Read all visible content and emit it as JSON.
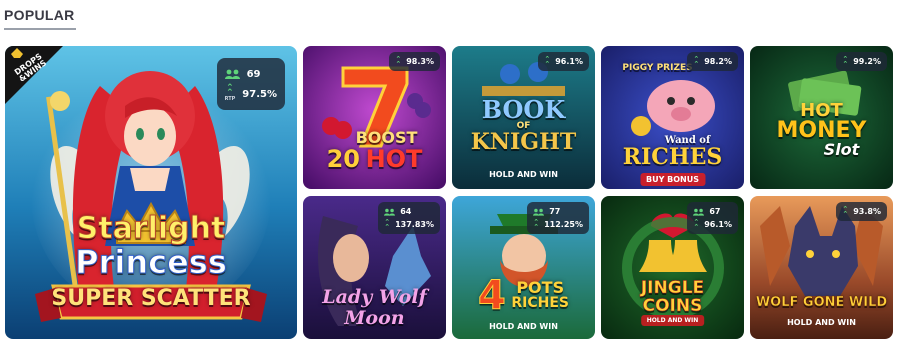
{
  "section": {
    "title": "POPULAR"
  },
  "featured": {
    "title_line1": "Starlight",
    "title_line2": "Princess",
    "title_line3": "SUPER SCATTER",
    "badge_line1": "DROPS",
    "badge_line2": "&WINS",
    "players": "69",
    "rtp": "97.5%",
    "rtp_label": "RTP"
  },
  "games": [
    {
      "id": "boost-hot",
      "title_line1": "20",
      "title_line2": "BOOST",
      "title_line3": "HOT",
      "rtp": "98.3%"
    },
    {
      "id": "book-of-knight",
      "title_line1": "BOOK",
      "title_line2": "OF",
      "title_line3": "KNIGHT",
      "tag": "HOLD AND WIN",
      "rtp": "96.1%"
    },
    {
      "id": "wand-of-riches",
      "title_line1": "PIGGY PRIZES",
      "title_line2": "Wand of",
      "title_line3": "RICHES",
      "tag": "BUY BONUS",
      "rtp": "98.2%"
    },
    {
      "id": "hot-money",
      "title_line1": "HOT",
      "title_line2": "MONEY",
      "title_line3": "Slot",
      "rtp": "99.2%"
    },
    {
      "id": "lady-wolf-moon",
      "title_line1": "Lady Wolf",
      "title_line2": "Moon",
      "players": "64",
      "rtp": "137.83%"
    },
    {
      "id": "4-pots-riches",
      "title_line1": "4",
      "title_line2": "POTS",
      "title_line3": "RICHES",
      "tag": "HOLD AND WIN",
      "players": "77",
      "rtp": "112.25%"
    },
    {
      "id": "jingle-coins",
      "title_line1": "JINGLE",
      "title_line2": "COINS",
      "tag": "HOLD AND WIN",
      "players": "67",
      "rtp": "96.1%"
    },
    {
      "id": "wolf-gone-wild",
      "title_line1": "WOLF GONE WILD",
      "tag": "HOLD AND WIN",
      "rtp": "93.8%"
    }
  ]
}
